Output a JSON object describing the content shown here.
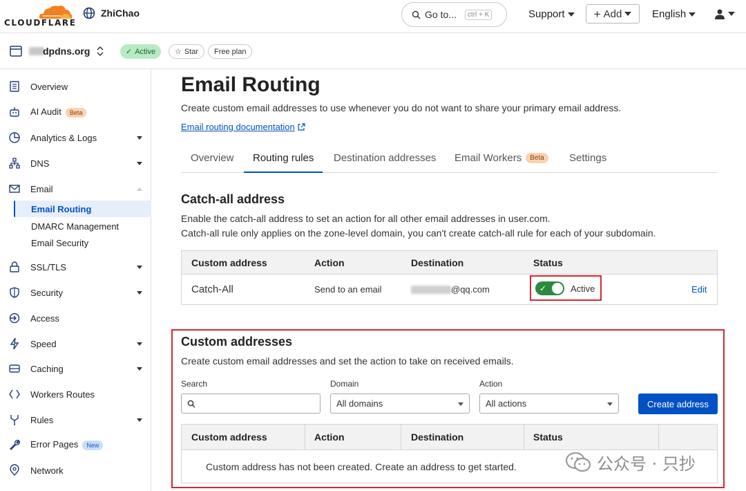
{
  "topbar": {
    "brand": "CLOUDFLARE",
    "account": "ZhiChao",
    "goto_label": "Go to...",
    "goto_shortcut": "ctrl + K",
    "support": "Support",
    "add": "Add",
    "language": "English"
  },
  "zone": {
    "name": "dpdns.org",
    "status": "Active",
    "star": "Star",
    "plan": "Free plan"
  },
  "sidebar": {
    "items": [
      {
        "label": "Overview",
        "icon": "document-icon"
      },
      {
        "label": "AI Audit",
        "icon": "robot-icon",
        "badge": "Beta"
      },
      {
        "label": "Analytics & Logs",
        "icon": "chart-icon"
      },
      {
        "label": "DNS",
        "icon": "network-icon"
      },
      {
        "label": "Email",
        "icon": "email-icon"
      },
      {
        "label": "SSL/TLS",
        "icon": "lock-icon"
      },
      {
        "label": "Security",
        "icon": "shield-icon"
      },
      {
        "label": "Access",
        "icon": "access-icon"
      },
      {
        "label": "Speed",
        "icon": "bolt-icon"
      },
      {
        "label": "Caching",
        "icon": "database-icon"
      },
      {
        "label": "Workers Routes",
        "icon": "workers-icon"
      },
      {
        "label": "Rules",
        "icon": "rules-icon"
      },
      {
        "label": "Error Pages",
        "icon": "wrench-icon",
        "badge": "New"
      },
      {
        "label": "Network",
        "icon": "pin-icon"
      }
    ],
    "email_sub": [
      "Email Routing",
      "DMARC Management",
      "Email Security"
    ]
  },
  "page": {
    "title": "Email Routing",
    "description": "Create custom email addresses to use whenever you do not want to share your primary email address.",
    "doc_link": "Email routing documentation"
  },
  "tabs": [
    "Overview",
    "Routing rules",
    "Destination addresses",
    "Email Workers",
    "Settings"
  ],
  "tab_badge": "Beta",
  "catch_all": {
    "title": "Catch-all address",
    "desc1": "Enable the catch-all address to set an action for all other email addresses in user.com.",
    "desc2": "Catch-all rule only applies on the zone-level domain, you can't create catch-all rule for each of your subdomain.",
    "headers": [
      "Custom address",
      "Action",
      "Destination",
      "Status"
    ],
    "row": {
      "address": "Catch-All",
      "action": "Send to an email",
      "destination": "@qq.com",
      "status": "Active",
      "edit": "Edit"
    }
  },
  "custom": {
    "title": "Custom addresses",
    "desc": "Create custom email addresses and set the action to take on received emails.",
    "search_label": "Search",
    "domain_label": "Domain",
    "domain_value": "All domains",
    "action_label": "Action",
    "action_value": "All actions",
    "create_button": "Create address",
    "headers": [
      "Custom address",
      "Action",
      "Destination",
      "Status"
    ],
    "empty": "Custom address has not been created. Create an address to get started."
  },
  "watermark": {
    "text": "公众号 · 只抄"
  }
}
